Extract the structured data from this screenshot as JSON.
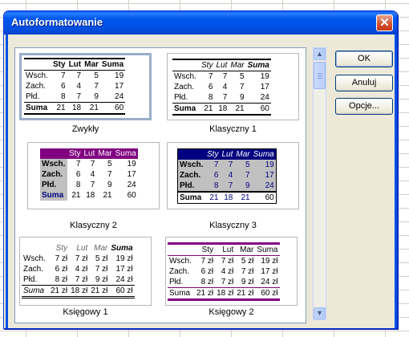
{
  "window": {
    "title": "Autoformatowanie",
    "close_label": "✕"
  },
  "buttons": {
    "ok": "OK",
    "cancel": "Anuluj",
    "options": "Opcje..."
  },
  "headers": [
    "Sty",
    "Lut",
    "Mar",
    "Suma"
  ],
  "row_labels": [
    "Wsch.",
    "Zach.",
    "Płd.",
    "Suma"
  ],
  "numbers": [
    [
      "7",
      "7",
      "5",
      "19"
    ],
    [
      "6",
      "4",
      "7",
      "17"
    ],
    [
      "8",
      "7",
      "9",
      "24"
    ],
    [
      "21",
      "18",
      "21",
      "60"
    ]
  ],
  "currency": [
    [
      "7 zł",
      "7 zł",
      "5 zł",
      "19 zł"
    ],
    [
      "6 zł",
      "4 zł",
      "7 zł",
      "17 zł"
    ],
    [
      "8 zł",
      "7 zł",
      "9 zł",
      "24 zł"
    ],
    [
      "21 zł",
      "18 zł",
      "21 zł",
      "60 zł"
    ]
  ],
  "formats": [
    "Zwykły",
    "Klasyczny 1",
    "Klasyczny 2",
    "Klasyczny 3",
    "Księgowy 1",
    "Księgowy 2"
  ],
  "colors": {
    "titlebar": "#0054e3",
    "purple": "#800080",
    "navy": "#000080",
    "gray_fill": "#c0c0c0"
  }
}
